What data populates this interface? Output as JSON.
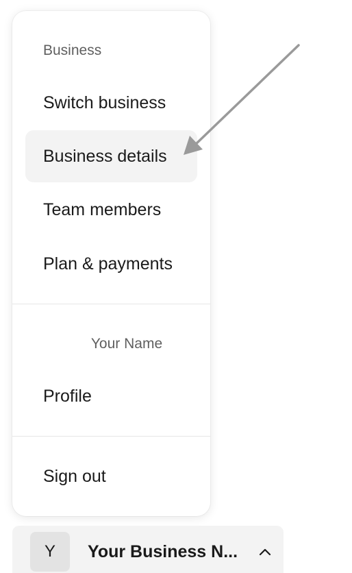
{
  "menu": {
    "business_heading": "Business",
    "items": [
      {
        "label": "Switch business",
        "icon": "none"
      },
      {
        "label": "Business details",
        "icon": "none"
      },
      {
        "label": "Team members",
        "icon": "none"
      },
      {
        "label": "Plan & payments",
        "icon": "none"
      }
    ],
    "user_heading": "Your Name",
    "profile_label": "Profile",
    "signout_label": "Sign out",
    "active_item": "Business details"
  },
  "account": {
    "avatar_initial": "Y",
    "business_name": "Your Business N...",
    "chevron_icon": "chevron-up-icon"
  },
  "annotation": {
    "arrow_color": "#9a9a9a",
    "points_to": "Business details"
  },
  "colors": {
    "active_bg": "#f3f3f3",
    "heading_text": "#5f5f5f",
    "body_text": "#1a1a1a"
  }
}
